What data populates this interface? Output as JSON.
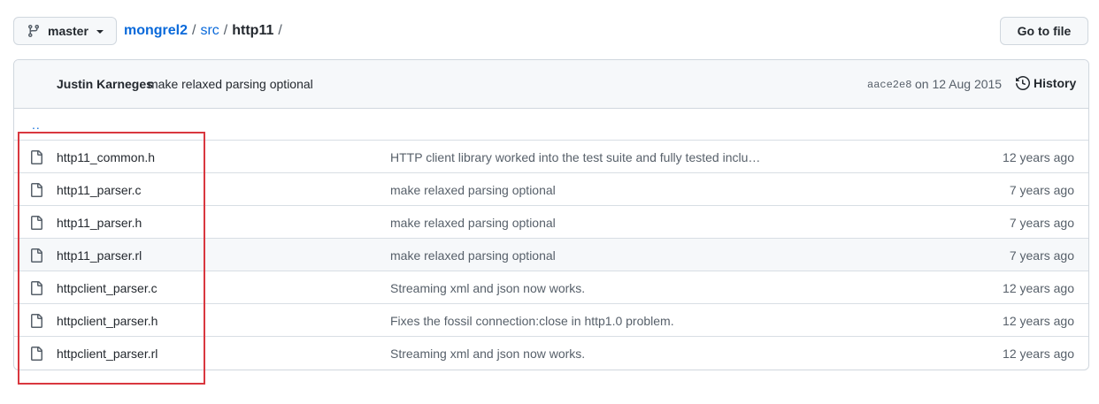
{
  "branch": {
    "label": "master"
  },
  "breadcrumb": {
    "repo": "mongrel2",
    "dir": "src",
    "current": "http11",
    "separator": "/"
  },
  "goto_file": "Go to file",
  "commit": {
    "author": "Justin Karneges",
    "message": "make relaxed parsing optional",
    "sha": "aace2e8",
    "date": "on 12 Aug 2015",
    "history": "History"
  },
  "updir": "..",
  "files": [
    {
      "name": "http11_common.h",
      "message": "HTTP client library worked into the test suite and fully tested inclu…",
      "age": "12 years ago"
    },
    {
      "name": "http11_parser.c",
      "message": "make relaxed parsing optional",
      "age": "7 years ago"
    },
    {
      "name": "http11_parser.h",
      "message": "make relaxed parsing optional",
      "age": "7 years ago"
    },
    {
      "name": "http11_parser.rl",
      "message": "make relaxed parsing optional",
      "age": "7 years ago"
    },
    {
      "name": "httpclient_parser.c",
      "message": "Streaming xml and json now works.",
      "age": "12 years ago"
    },
    {
      "name": "httpclient_parser.h",
      "message": "Fixes the fossil connection:close in http1.0 problem.",
      "age": "12 years ago"
    },
    {
      "name": "httpclient_parser.rl",
      "message": "Streaming xml and json now works.",
      "age": "12 years ago"
    }
  ],
  "colors": {
    "link": "#0969da",
    "highlight_box": "#d9373f",
    "border": "#d0d7de"
  }
}
